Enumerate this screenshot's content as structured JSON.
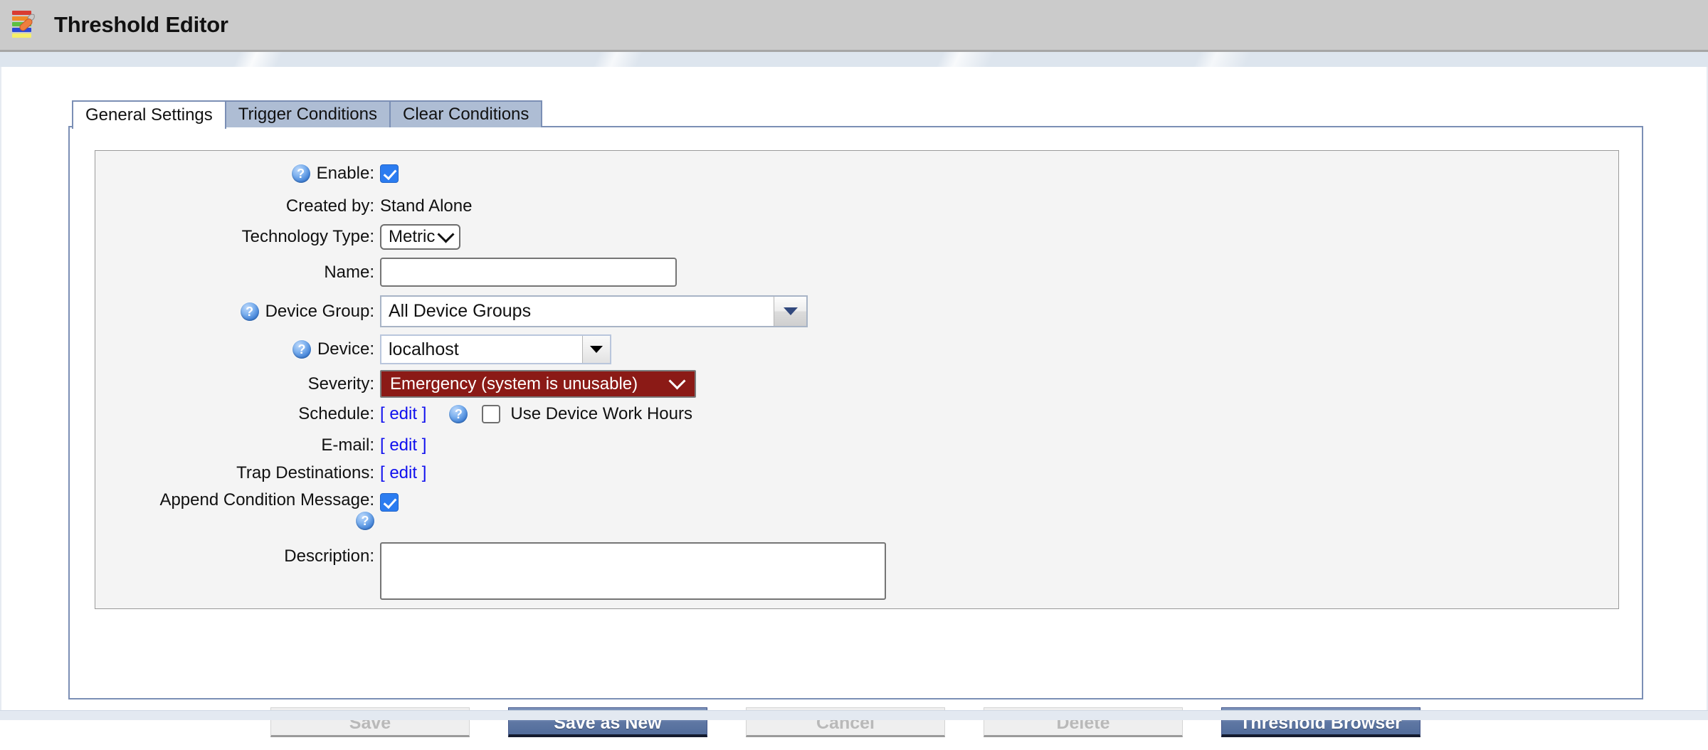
{
  "window": {
    "title": "Threshold Editor",
    "icon": "threshold-editor-icon"
  },
  "tabs": [
    {
      "label": "General Settings",
      "active": true
    },
    {
      "label": "Trigger Conditions",
      "active": false
    },
    {
      "label": "Clear Conditions",
      "active": false
    }
  ],
  "form": {
    "enable": {
      "label": "Enable:",
      "checked": true,
      "help": "help-icon"
    },
    "created_by": {
      "label": "Created by:",
      "value": "Stand Alone"
    },
    "technology_type": {
      "label": "Technology Type:",
      "value": "Metric"
    },
    "name": {
      "label": "Name:",
      "value": "",
      "placeholder": ""
    },
    "device_group": {
      "label": "Device Group:",
      "value": "All Device Groups"
    },
    "device": {
      "label": "Device:",
      "value": "localhost"
    },
    "severity": {
      "label": "Severity:",
      "value": "Emergency (system is unusable)",
      "color": "#8b1a16"
    },
    "schedule": {
      "label": "Schedule:",
      "edit_label": "[ edit ]"
    },
    "use_device_work_hours": {
      "label": "Use Device Work Hours",
      "checked": false
    },
    "email": {
      "label": "E-mail:",
      "edit_label": "[ edit ]"
    },
    "trap_destinations": {
      "label": "Trap Destinations:",
      "edit_label": "[ edit ]"
    },
    "append_condition_message": {
      "label": "Append Condition Message:",
      "checked": true
    },
    "description": {
      "label": "Description:",
      "value": "",
      "placeholder": ""
    }
  },
  "buttons": {
    "save": {
      "label": "Save",
      "enabled": false
    },
    "save_as_new": {
      "label": "Save as New",
      "enabled": true
    },
    "cancel": {
      "label": "Cancel",
      "enabled": false
    },
    "delete": {
      "label": "Delete",
      "enabled": false
    },
    "threshold_browser": {
      "label": "Threshold Browser",
      "enabled": true
    }
  },
  "colors": {
    "titlebar": "#cbcbcb",
    "tab_inactive": "#aebdd4",
    "panel_border": "#7b8fb5",
    "primary_button": "#6e86b0",
    "severity_emergency": "#8b1a16",
    "link": "#1111ee"
  },
  "glyphs": {
    "help": "?"
  }
}
